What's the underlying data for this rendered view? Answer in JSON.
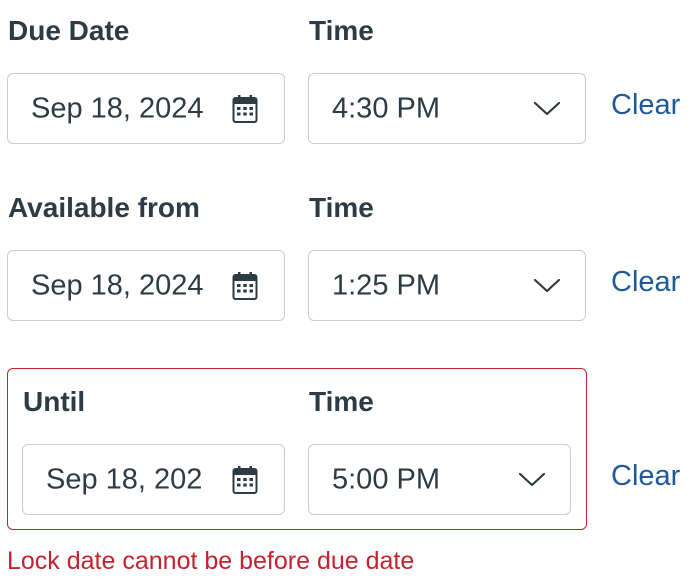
{
  "due": {
    "label": "Due Date",
    "time_label": "Time",
    "date_value": "Sep 18, 2024",
    "time_value": "4:30 PM",
    "clear_label": "Clear"
  },
  "available_from": {
    "label": "Available from",
    "time_label": "Time",
    "date_value": "Sep 18, 2024",
    "time_value": "1:25 PM",
    "clear_label": "Clear"
  },
  "until": {
    "label": "Until",
    "time_label": "Time",
    "date_value": "Sep 18, 202",
    "time_value": "5:00 PM",
    "clear_label": "Clear",
    "error_message": "Lock date cannot be before due date"
  },
  "icons": {
    "calendar": "calendar-icon",
    "chevron": "chevron-down-icon"
  },
  "colors": {
    "text": "#2d3b45",
    "link": "#1e5a96",
    "error": "#c52231",
    "border": "#c7cdd1"
  }
}
